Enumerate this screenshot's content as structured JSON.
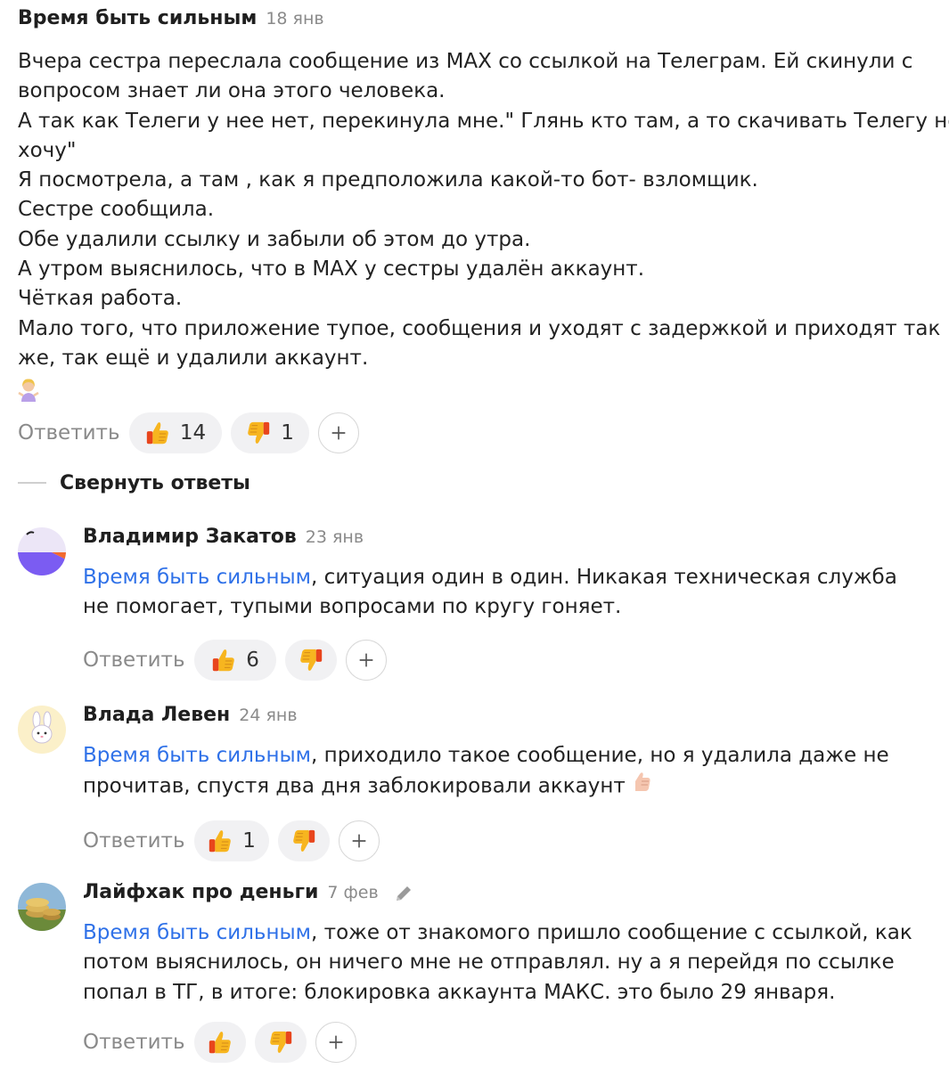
{
  "main_comment": {
    "author": "Время быть сильным",
    "date": "18 янв",
    "lines": [
      "Вчера сестра переслала сообщение из MAX со ссылкой на Телеграм. Ей скинули с",
      "вопросом знает ли она этого человека.",
      "А так как Телеги у нее нет, перекинула мне.\" Глянь кто там, а то скачивать Телегу не",
      "хочу\"",
      "Я посмотрела, а там , как я предположила какой-то бот- взломщик.",
      "Сестре сообщила.",
      "Обе удалили ссылку и забыли об этом до утра.",
      "А утром выяснилось, что в MAX у сестры удалён аккаунт.",
      "Чёткая работа.",
      "Мало того, что приложение тупое, сообщения и уходят с задержкой и приходят так",
      "же, так ещё и удалили аккаунт."
    ],
    "emoji_icon": "woman-shrugging-emoji",
    "reply_label": "Ответить",
    "likes": "14",
    "dislikes": "1"
  },
  "collapse_label": "Свернуть ответы",
  "replies": [
    {
      "author": "Владимир Закатов",
      "date": "23 янв",
      "mention": "Время быть сильным",
      "line1_rest": ", ситуация один в один. Никакая техническая служба",
      "line2": "не помогает, тупыми вопросами по кругу гоняет.",
      "reply_label": "Ответить",
      "likes": "6",
      "dislikes": ""
    },
    {
      "author": "Влада Левен",
      "date": "24 янв",
      "mention": "Время быть сильным",
      "line1_rest": ", приходило такое сообщение, но я удалила даже не",
      "line2": "прочитав, спустя два дня заблокировали аккаунт",
      "reply_label": "Ответить",
      "likes": "1",
      "dislikes": ""
    },
    {
      "author": "Лайфхак про деньги",
      "date": "7 фев",
      "mention": "Время быть сильным",
      "line1_rest": ", тоже от знакомого пришло сообщение с ссылкой, как",
      "line2": "потом выяснилось, он ничего мне не отправлял. ну а я перейдя по ссылке",
      "line3": "попал в ТГ, в итоге: блокировка аккаунта МАКС. это было 29 января.",
      "reply_label": "Ответить",
      "likes": "",
      "dislikes": ""
    }
  ],
  "colors": {
    "mention": "#2f71e8",
    "muted": "#8a8a8a",
    "pill_bg": "#f1f1f3"
  }
}
